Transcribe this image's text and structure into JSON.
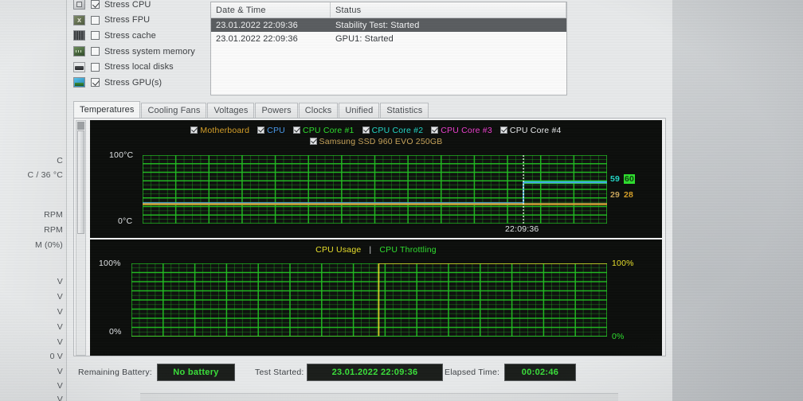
{
  "background_window": {
    "lines": [
      "C",
      "C / 36 °C",
      "RPM",
      "RPM",
      "M  (0%)",
      "V",
      "V",
      "V",
      "V",
      "V",
      "0 V",
      "V",
      "V",
      "V"
    ]
  },
  "stress_options": {
    "items": [
      {
        "label": "Stress CPU",
        "icon": "cpu-icon",
        "checked": true
      },
      {
        "label": "Stress FPU",
        "icon": "fpu-icon",
        "checked": false
      },
      {
        "label": "Stress cache",
        "icon": "cache-icon",
        "checked": false
      },
      {
        "label": "Stress system memory",
        "icon": "memory-icon",
        "checked": false
      },
      {
        "label": "Stress local disks",
        "icon": "disk-icon",
        "checked": false
      },
      {
        "label": "Stress GPU(s)",
        "icon": "gpu-icon",
        "checked": true
      }
    ]
  },
  "log": {
    "columns": [
      "Date & Time",
      "Status"
    ],
    "rows": [
      {
        "datetime": "23.01.2022 22:09:36",
        "status": "Stability Test: Started",
        "selected": true
      },
      {
        "datetime": "23.01.2022 22:09:36",
        "status": "GPU1: Started",
        "selected": false
      }
    ]
  },
  "tabs": [
    {
      "label": "Temperatures",
      "active": true
    },
    {
      "label": "Cooling Fans",
      "active": false
    },
    {
      "label": "Voltages",
      "active": false
    },
    {
      "label": "Powers",
      "active": false
    },
    {
      "label": "Clocks",
      "active": false
    },
    {
      "label": "Unified",
      "active": false
    },
    {
      "label": "Statistics",
      "active": false
    }
  ],
  "chart_data": [
    {
      "type": "line",
      "name": "temperatures-chart",
      "title": "",
      "xlabel": "",
      "ylabel": "",
      "ylim": [
        0,
        100
      ],
      "y_top_label": "100°C",
      "y_bottom_label": "0°C",
      "time_marker_label": "22:09:36",
      "grid": true,
      "grid_color": "#22c022",
      "legend_position": "top-center",
      "legend": [
        {
          "label": "Motherboard",
          "color": "#d8a128",
          "checked": true
        },
        {
          "label": "CPU",
          "color": "#4a9cf0",
          "checked": true
        },
        {
          "label": "CPU Core #1",
          "color": "#2ee02e",
          "checked": true
        },
        {
          "label": "CPU Core #2",
          "color": "#22d8c8",
          "checked": true
        },
        {
          "label": "CPU Core #3",
          "color": "#ef3fd0",
          "checked": true
        },
        {
          "label": "CPU Core #4",
          "color": "#e8eaec",
          "checked": true
        },
        {
          "label": "Samsung SSD 960 EVO 250GB",
          "color": "#c8a45a",
          "checked": true
        }
      ],
      "value_labels": [
        {
          "text": "59",
          "color": "#22d8c8",
          "highlight": false
        },
        {
          "text": "60",
          "color": "#0e3f0e",
          "highlight": true,
          "highlight_bg": "#2ee02e"
        },
        {
          "text": "29",
          "color": "#c8a45a",
          "highlight": false
        },
        {
          "text": "28",
          "color": "#d8a128",
          "highlight": false
        }
      ],
      "series": [
        {
          "name": "CPU Core #2",
          "color": "#22d8c8",
          "pre_value": 30,
          "post_value": 61
        },
        {
          "name": "CPU Core #1",
          "color": "#2ee02e",
          "pre_value": 28,
          "post_value": 59
        },
        {
          "name": "CPU",
          "color": "#4a9cf0",
          "pre_value": 30,
          "post_value": 60
        },
        {
          "name": "Samsung SSD 960 EVO 250GB",
          "color": "#c8a45a",
          "pre_value": 29,
          "post_value": 29
        },
        {
          "name": "Motherboard",
          "color": "#d8a128",
          "pre_value": 28,
          "post_value": 28
        }
      ],
      "event_at_fraction": 0.82
    },
    {
      "type": "line",
      "name": "cpu-usage-chart",
      "title": "",
      "xlabel": "",
      "ylabel": "",
      "ylim": [
        0,
        100
      ],
      "y_top_label": "100%",
      "y_bottom_label": "0%",
      "right_top_label": "100%",
      "right_bottom_label": "0%",
      "grid": true,
      "grid_color": "#22c022",
      "legend_position": "top-center",
      "legend": [
        {
          "label": "CPU Usage",
          "color": "#e8e02a"
        },
        {
          "label": "|",
          "color": "#cfd2d4"
        },
        {
          "label": "CPU Throttling",
          "color": "#2ee02e"
        }
      ],
      "series": [
        {
          "name": "CPU Usage",
          "color": "#e8e02a",
          "pre_value": 0,
          "post_value": 100
        },
        {
          "name": "CPU Throttling",
          "color": "#2ee02e",
          "pre_value": 0,
          "post_value": 0
        }
      ],
      "event_at_fraction": 0.52
    }
  ],
  "footer": {
    "remaining_battery_label": "Remaining Battery:",
    "remaining_battery_value": "No battery",
    "test_started_label": "Test Started:",
    "test_started_value": "23.01.2022 22:09:36",
    "elapsed_time_label": "Elapsed Time:",
    "elapsed_time_value": "00:02:46"
  }
}
